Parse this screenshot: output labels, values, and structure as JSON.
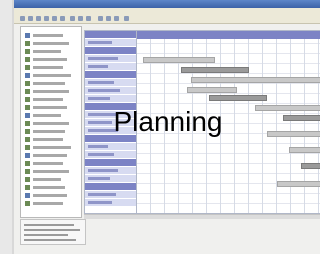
{
  "overlay": {
    "title": "Planning"
  }
}
